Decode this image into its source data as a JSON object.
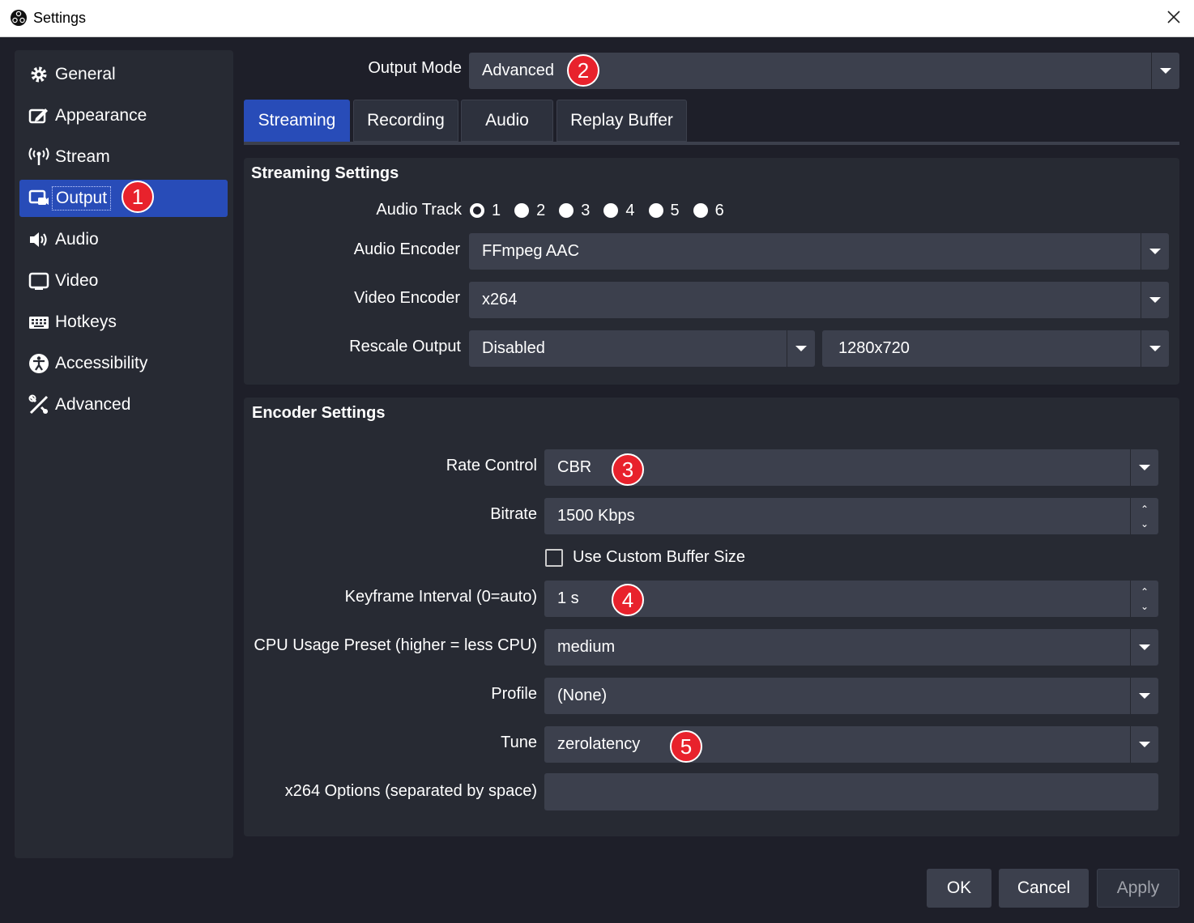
{
  "window": {
    "title": "Settings"
  },
  "sidebar": {
    "items": [
      {
        "label": "General",
        "icon": "gear-icon"
      },
      {
        "label": "Appearance",
        "icon": "appearance-icon"
      },
      {
        "label": "Stream",
        "icon": "antenna-icon"
      },
      {
        "label": "Output",
        "icon": "output-icon"
      },
      {
        "label": "Audio",
        "icon": "speaker-icon"
      },
      {
        "label": "Video",
        "icon": "monitor-icon"
      },
      {
        "label": "Hotkeys",
        "icon": "keyboard-icon"
      },
      {
        "label": "Accessibility",
        "icon": "accessibility-icon"
      },
      {
        "label": "Advanced",
        "icon": "tools-icon"
      }
    ],
    "selected": "Output"
  },
  "output_mode": {
    "label": "Output Mode",
    "value": "Advanced"
  },
  "tabs": [
    "Streaming",
    "Recording",
    "Audio",
    "Replay Buffer"
  ],
  "streaming_settings": {
    "title": "Streaming Settings",
    "audio_track": {
      "label": "Audio Track",
      "options": [
        "1",
        "2",
        "3",
        "4",
        "5",
        "6"
      ],
      "selected": "1"
    },
    "audio_encoder": {
      "label": "Audio Encoder",
      "value": "FFmpeg AAC"
    },
    "video_encoder": {
      "label": "Video Encoder",
      "value": "x264"
    },
    "rescale_output": {
      "label": "Rescale Output",
      "value": "Disabled",
      "resolution": "1280x720"
    }
  },
  "encoder_settings": {
    "title": "Encoder Settings",
    "rate_control": {
      "label": "Rate Control",
      "value": "CBR"
    },
    "bitrate": {
      "label": "Bitrate",
      "value": "1500 Kbps"
    },
    "custom_buffer": {
      "label": "Use Custom Buffer Size",
      "checked": false
    },
    "keyframe_interval": {
      "label": "Keyframe Interval (0=auto)",
      "value": "1 s"
    },
    "cpu_preset": {
      "label": "CPU Usage Preset (higher = less CPU)",
      "value": "medium"
    },
    "profile": {
      "label": "Profile",
      "value": "(None)"
    },
    "tune": {
      "label": "Tune",
      "value": "zerolatency"
    },
    "x264_options": {
      "label": "x264 Options (separated by space)",
      "value": ""
    }
  },
  "annotations": [
    "1",
    "2",
    "3",
    "4",
    "5"
  ],
  "buttons": {
    "ok": "OK",
    "cancel": "Cancel",
    "apply": "Apply"
  },
  "colors": {
    "accent": "#284cb8",
    "badge": "#e8222c",
    "background": "#1e1f29",
    "panel": "#272a33",
    "field": "#3c404d"
  }
}
